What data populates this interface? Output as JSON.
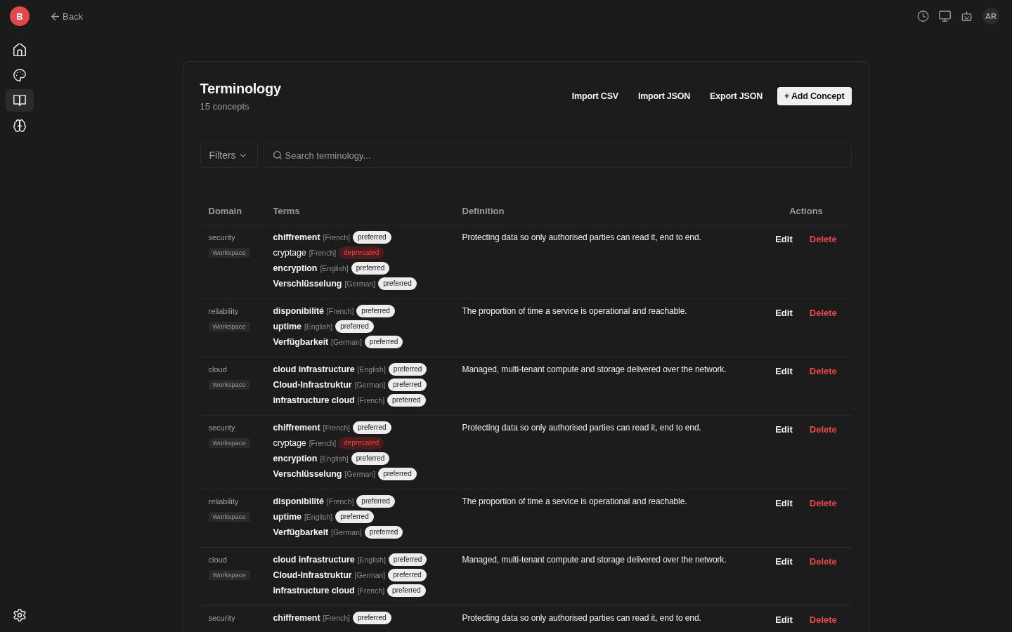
{
  "sidebar": {
    "logo": "B",
    "items": [
      {
        "selected": false
      },
      {
        "selected": false
      },
      {
        "selected": true
      },
      {
        "selected": false
      }
    ]
  },
  "top_bar": {
    "back": "Back",
    "avatar": "AR"
  },
  "header": {
    "title": "Terminology",
    "subtitle": "15 concepts",
    "actions": [
      "Import CSV",
      "Import JSON",
      "Export JSON"
    ],
    "primary_action": "+ Add Concept"
  },
  "toolbar": {
    "filters": "Filters",
    "search": {
      "placeholder": "Search terminology..."
    }
  },
  "table": {
    "columns": [
      "Domain",
      "Terms",
      "Definition",
      "Actions"
    ],
    "rows": [
      {
        "domain": "security",
        "scope": "Workspace",
        "terms": [
          {
            "term": "chiffrement",
            "language": "[French]",
            "status": "preferred",
            "deprecated": false
          },
          {
            "term": "cryptage",
            "language": "[French]",
            "status": "deprecated",
            "deprecated": true
          },
          {
            "term": "encryption",
            "language": "[English]",
            "status": "preferred",
            "deprecated": false
          },
          {
            "term": "Verschlüsselung",
            "language": "[German]",
            "status": "preferred",
            "deprecated": false
          }
        ],
        "definition": "Protecting data so only authorised parties can read it, end to end.",
        "actions": [
          {
            "label": "Edit",
            "kind": "edit"
          },
          {
            "label": "Delete",
            "kind": "delete"
          }
        ]
      },
      {
        "domain": "reliability",
        "scope": "Workspace",
        "terms": [
          {
            "term": "disponibilité",
            "language": "[French]",
            "status": "preferred",
            "deprecated": false
          },
          {
            "term": "uptime",
            "language": "[English]",
            "status": "preferred",
            "deprecated": false
          },
          {
            "term": "Verfügbarkeit",
            "language": "[German]",
            "status": "preferred",
            "deprecated": false
          }
        ],
        "definition": "The proportion of time a service is operational and reachable.",
        "actions": [
          {
            "label": "Edit",
            "kind": "edit"
          },
          {
            "label": "Delete",
            "kind": "delete"
          }
        ]
      },
      {
        "domain": "cloud",
        "scope": "Workspace",
        "terms": [
          {
            "term": "cloud infrastructure",
            "language": "[English]",
            "status": "preferred",
            "deprecated": false
          },
          {
            "term": "Cloud-Infrastruktur",
            "language": "[German]",
            "status": "preferred",
            "deprecated": false
          },
          {
            "term": "infrastructure cloud",
            "language": "[French]",
            "status": "preferred",
            "deprecated": false
          }
        ],
        "definition": "Managed, multi-tenant compute and storage delivered over the network.",
        "actions": [
          {
            "label": "Edit",
            "kind": "edit"
          },
          {
            "label": "Delete",
            "kind": "delete"
          }
        ]
      },
      {
        "domain": "security",
        "scope": "Workspace",
        "terms": [
          {
            "term": "chiffrement",
            "language": "[French]",
            "status": "preferred",
            "deprecated": false
          },
          {
            "term": "cryptage",
            "language": "[French]",
            "status": "deprecated",
            "deprecated": true
          },
          {
            "term": "encryption",
            "language": "[English]",
            "status": "preferred",
            "deprecated": false
          },
          {
            "term": "Verschlüsselung",
            "language": "[German]",
            "status": "preferred",
            "deprecated": false
          }
        ],
        "definition": "Protecting data so only authorised parties can read it, end to end.",
        "actions": [
          {
            "label": "Edit",
            "kind": "edit"
          },
          {
            "label": "Delete",
            "kind": "delete"
          }
        ]
      },
      {
        "domain": "reliability",
        "scope": "Workspace",
        "terms": [
          {
            "term": "disponibilité",
            "language": "[French]",
            "status": "preferred",
            "deprecated": false
          },
          {
            "term": "uptime",
            "language": "[English]",
            "status": "preferred",
            "deprecated": false
          },
          {
            "term": "Verfügbarkeit",
            "language": "[German]",
            "status": "preferred",
            "deprecated": false
          }
        ],
        "definition": "The proportion of time a service is operational and reachable.",
        "actions": [
          {
            "label": "Edit",
            "kind": "edit"
          },
          {
            "label": "Delete",
            "kind": "delete"
          }
        ]
      },
      {
        "domain": "cloud",
        "scope": "Workspace",
        "terms": [
          {
            "term": "cloud infrastructure",
            "language": "[English]",
            "status": "preferred",
            "deprecated": false
          },
          {
            "term": "Cloud-Infrastruktur",
            "language": "[German]",
            "status": "preferred",
            "deprecated": false
          },
          {
            "term": "infrastructure cloud",
            "language": "[French]",
            "status": "preferred",
            "deprecated": false
          }
        ],
        "definition": "Managed, multi-tenant compute and storage delivered over the network.",
        "actions": [
          {
            "label": "Edit",
            "kind": "edit"
          },
          {
            "label": "Delete",
            "kind": "delete"
          }
        ]
      },
      {
        "domain": "security",
        "terms": [
          {
            "term": "chiffrement",
            "language": "[French]",
            "status": "preferred",
            "deprecated": false
          }
        ],
        "definition": "Protecting data so only authorised parties can read it, end to end.",
        "actions": [
          {
            "label": "Edit",
            "kind": "edit"
          },
          {
            "label": "Delete",
            "kind": "delete"
          }
        ]
      }
    ]
  }
}
